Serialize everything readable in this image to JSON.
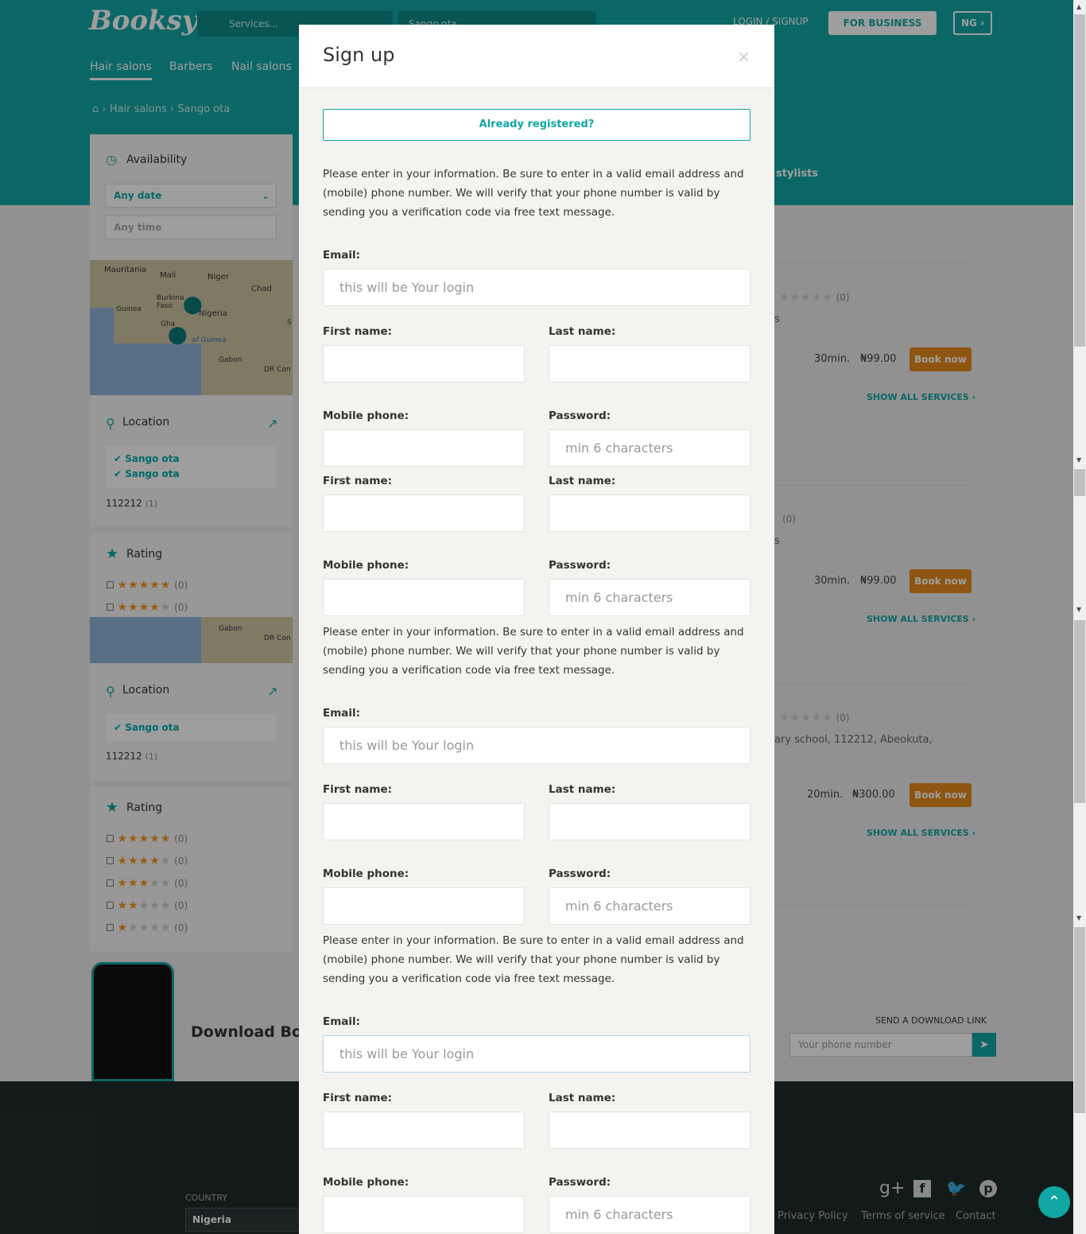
{
  "header": {
    "logo": "Booksy",
    "service_placeholder": "Services...",
    "location_value": "Sango ota",
    "login_signup": "LOGIN / SIGNUP",
    "for_business": "FOR BUSINESS",
    "country_code": "NG",
    "nav": [
      "Hair salons",
      "Barbers",
      "Nail salons"
    ],
    "breadcrumb": [
      "Hair salons",
      "Sango ota"
    ],
    "stylists_link": "stylists"
  },
  "sidebar": {
    "availability_title": "Availability",
    "any_date": "Any date",
    "any_time": "Any time",
    "map_labels": [
      "Mauritania",
      "Mali",
      "Niger",
      "Chad",
      "Guinea",
      "Burkina Faso",
      "Nigeria",
      "Gabon",
      "DR Con",
      "of Guinea",
      "Gha",
      "S"
    ],
    "location_title": "Location",
    "locations_first": [
      "Sango ota",
      "Sango ota"
    ],
    "locations_second": [
      "Sango ota"
    ],
    "postcode": "112212",
    "postcode_count": "(1)",
    "rating_title": "Rating",
    "rating_rows": [
      {
        "stars": 5,
        "count": "(0)"
      },
      {
        "stars": 4,
        "count": "(0)"
      },
      {
        "stars": 3,
        "count": "(0)"
      },
      {
        "stars": 2,
        "count": "(0)"
      },
      {
        "stars": 1,
        "count": "(0)"
      }
    ]
  },
  "results": [
    {
      "rating_count": "(0)",
      "snippet": "s",
      "duration": "30min.",
      "price": "₦99.00",
      "book": "Book now",
      "show_all": "SHOW ALL SERVICES"
    },
    {
      "rating_count": "(0)",
      "snippet": "s",
      "duration": "30min.",
      "price": "₦99.00",
      "book": "Book now",
      "show_all": "SHOW ALL SERVICES"
    },
    {
      "rating_count": "(0)",
      "snippet": "ary school, 112212, Abeokuta,",
      "duration": "20min.",
      "price": "₦300.00",
      "book": "Book now",
      "show_all": "SHOW ALL SERVICES"
    }
  ],
  "download": {
    "title": "Download Boo",
    "send_link": "SEND A DOWNLOAD LINK",
    "phone_placeholder": "Your phone number"
  },
  "footer": {
    "country_label": "COUNTRY",
    "country_value": "Nigeria",
    "links": [
      "Privacy Policy",
      "Terms of service",
      "Contact"
    ]
  },
  "modal": {
    "title": "Sign up",
    "close": "×",
    "already_registered": "Already registered?",
    "info_text": "Please enter in your information. Be sure to enter in a valid email address and (mobile) phone number. We will verify that your phone number is valid by sending you a verification code via free text message.",
    "email_label": "Email:",
    "email_placeholder": "this will be Your login",
    "first_name_label": "First name:",
    "last_name_label": "Last name:",
    "mobile_label": "Mobile phone:",
    "password_label": "Password:",
    "password_placeholder": "min 6 characters"
  }
}
